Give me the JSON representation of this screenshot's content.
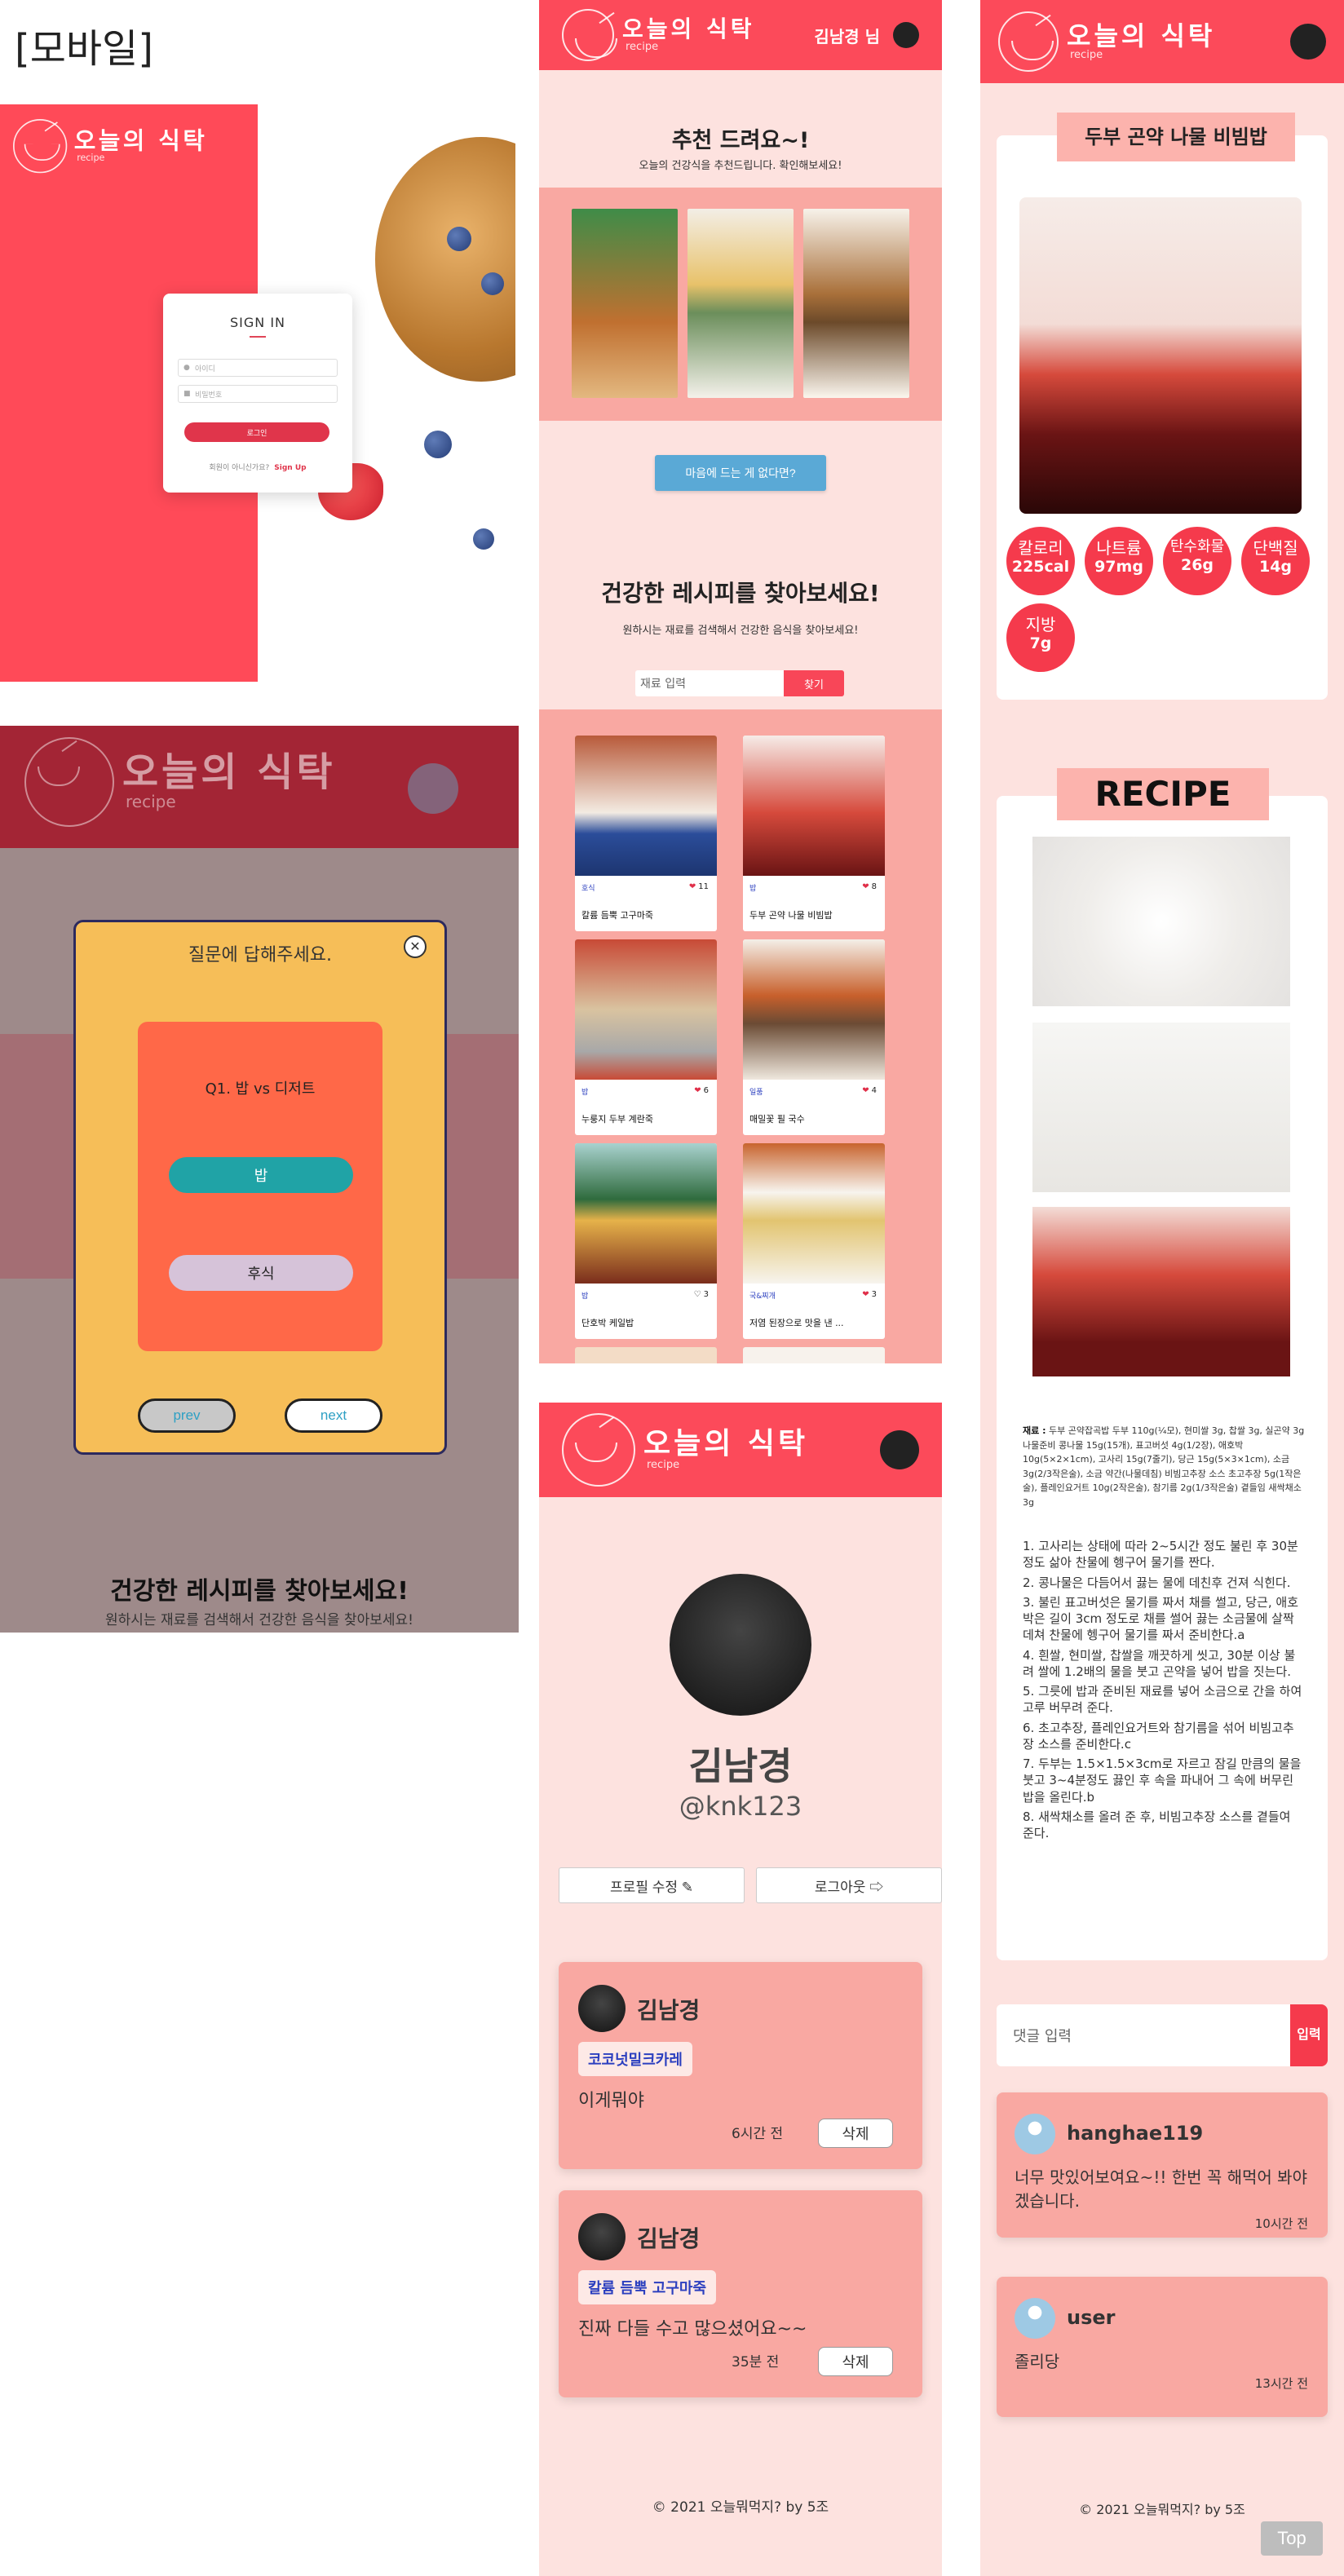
{
  "section_label": "[모바일]",
  "brand": {
    "title": "오늘의 식탁",
    "sub": "recipe"
  },
  "login": {
    "title": "SIGN IN",
    "id_placeholder": "아이디",
    "pw_placeholder": "비밀번호",
    "login_button": "로그인",
    "footer_text": "회원이 아니신가요?",
    "signup_link": "Sign Up"
  },
  "quiz": {
    "title": "질문에 답해주세요.",
    "close": "✕",
    "question": "Q1. 밥 vs 디저트",
    "option_1": "밥",
    "option_2": "후식",
    "prev": "prev",
    "next": "next",
    "behind_heading": "건강한 레시피를 찾아보세요!",
    "behind_sub": "원하시는 재료를 검색해서 건강한 음식을 찾아보세요!"
  },
  "main": {
    "user": "김남경 님",
    "rec_title": "추천 드려요~!",
    "rec_sub": "오늘의 건강식을 추천드립니다. 확인해보세요!",
    "rec_button": "마음에 드는 게 없다면?",
    "find_title": "건강한 레시피를 찾아보세요!",
    "find_sub": "원하시는 재료를 검색해서 건강한 음식을 찾아보세요!",
    "search_placeholder": "재료 입력",
    "search_button": "찾기",
    "cards": [
      {
        "category": "호식",
        "likes": "11",
        "name": "칼륨 듬뿍 고구마죽"
      },
      {
        "category": "밥",
        "likes": "8",
        "name": "두부 곤약 나물 비빔밥"
      },
      {
        "category": "밥",
        "likes": "6",
        "name": "누룽지 두부 계란죽"
      },
      {
        "category": "일품",
        "likes": "4",
        "name": "매밀꽃 필 국수"
      },
      {
        "category": "밥",
        "likes": "3",
        "name": "단호박 케일밥"
      },
      {
        "category": "국&찌개",
        "likes": "3",
        "name": "저염 된장으로 맛을 낸 ..."
      }
    ]
  },
  "profile": {
    "name": "김남경",
    "id": "@knk123",
    "edit_button": "프로필 수정 ✎",
    "logout_button": "로그아웃 ⇨",
    "comments": [
      {
        "name": "김남경",
        "tag": "코코넛밀크카레",
        "text": "이게뭐야",
        "time": "6시간 전",
        "delete": "삭제"
      },
      {
        "name": "김남경",
        "tag": "칼륨 듬뿍 고구마죽",
        "text": "진짜 다들 수고 많으셨어요~~",
        "time": "35분 전",
        "delete": "삭제"
      }
    ],
    "footer": "© 2021 오늘뭐먹지? by 5조"
  },
  "detail": {
    "title": "두부 곤약 나물 비빔밥",
    "nutrition": [
      {
        "label": "칼로리",
        "value": "225cal"
      },
      {
        "label": "나트륨",
        "value": "97mg"
      },
      {
        "label": "탄수화물",
        "value": "26g"
      },
      {
        "label": "단백질",
        "value": "14g"
      },
      {
        "label": "지방",
        "value": "7g"
      }
    ],
    "recipe_title": "RECIPE",
    "ingredients_label": "재료 :",
    "ingredients": "두부 곤약잡곡밥 두부 110g(¼모), 현미쌀 3g, 찹쌀 3g, 실곤약 3g 나물준비 콩나물 15g(15개), 표고버섯 4g(1/2장), 애호박 10g(5×2×1cm), 고사리 15g(7줄기), 당근 15g(5×3×1cm), 소금 3g(2/3작은술), 소금 약간(나물데침) 비빔고추장 소스 초고추장 5g(1작은술), 플레인요거트 10g(2작은술), 참기름 2g(1/3작은술) 곁들임 새싹채소 3g",
    "steps": [
      "1. 고사리는 상태에 따라 2~5시간 정도 불린 후 30분 정도 삶아 찬물에 헹구어 물기를 짠다.",
      "2. 콩나물은 다듬어서 끓는 물에 데친후 건져 식힌다.",
      "3. 불린 표고버섯은 물기를 짜서 채를 썰고, 당근, 애호박은 길이 3cm 정도로 채를 썰어 끓는 소금물에 살짝 데쳐 찬물에 헹구어 물기를 짜서 준비한다.a",
      "4. 흰쌀, 현미쌀, 찹쌀을 깨끗하게 씻고, 30분 이상 불려 쌀에 1.2배의 물을 붓고 곤약을 넣어 밥을 짓는다.",
      "5. 그릇에 밥과 준비된 재료를 넣어 소금으로 간을 하여 고루 버무려 준다.",
      "6. 초고추장, 플레인요거트와 참기름을 섞어 비빔고추장 소스를 준비한다.c",
      "7. 두부는 1.5×1.5×3cm로 자르고 잠길 만큼의 물을 붓고 3~4분정도 끓인 후 속을 파내어 그 속에 버무린 밥을 올린다.b",
      "8. 새싹채소를 올려 준 후, 비빔고추장 소스를 곁들여 준다."
    ],
    "comment_placeholder": "댓글 입력",
    "comment_button": "입력",
    "comments": [
      {
        "name": "hanghae119",
        "text": "너무 맛있어보여요~!! 한번 꼭 해먹어 봐야겠습니다.",
        "time": "10시간 전"
      },
      {
        "name": "user",
        "text": "졸리당",
        "time": "13시간 전"
      }
    ],
    "footer": "© 2021 오늘뭐먹지? by 5조",
    "top_button": "Top"
  }
}
